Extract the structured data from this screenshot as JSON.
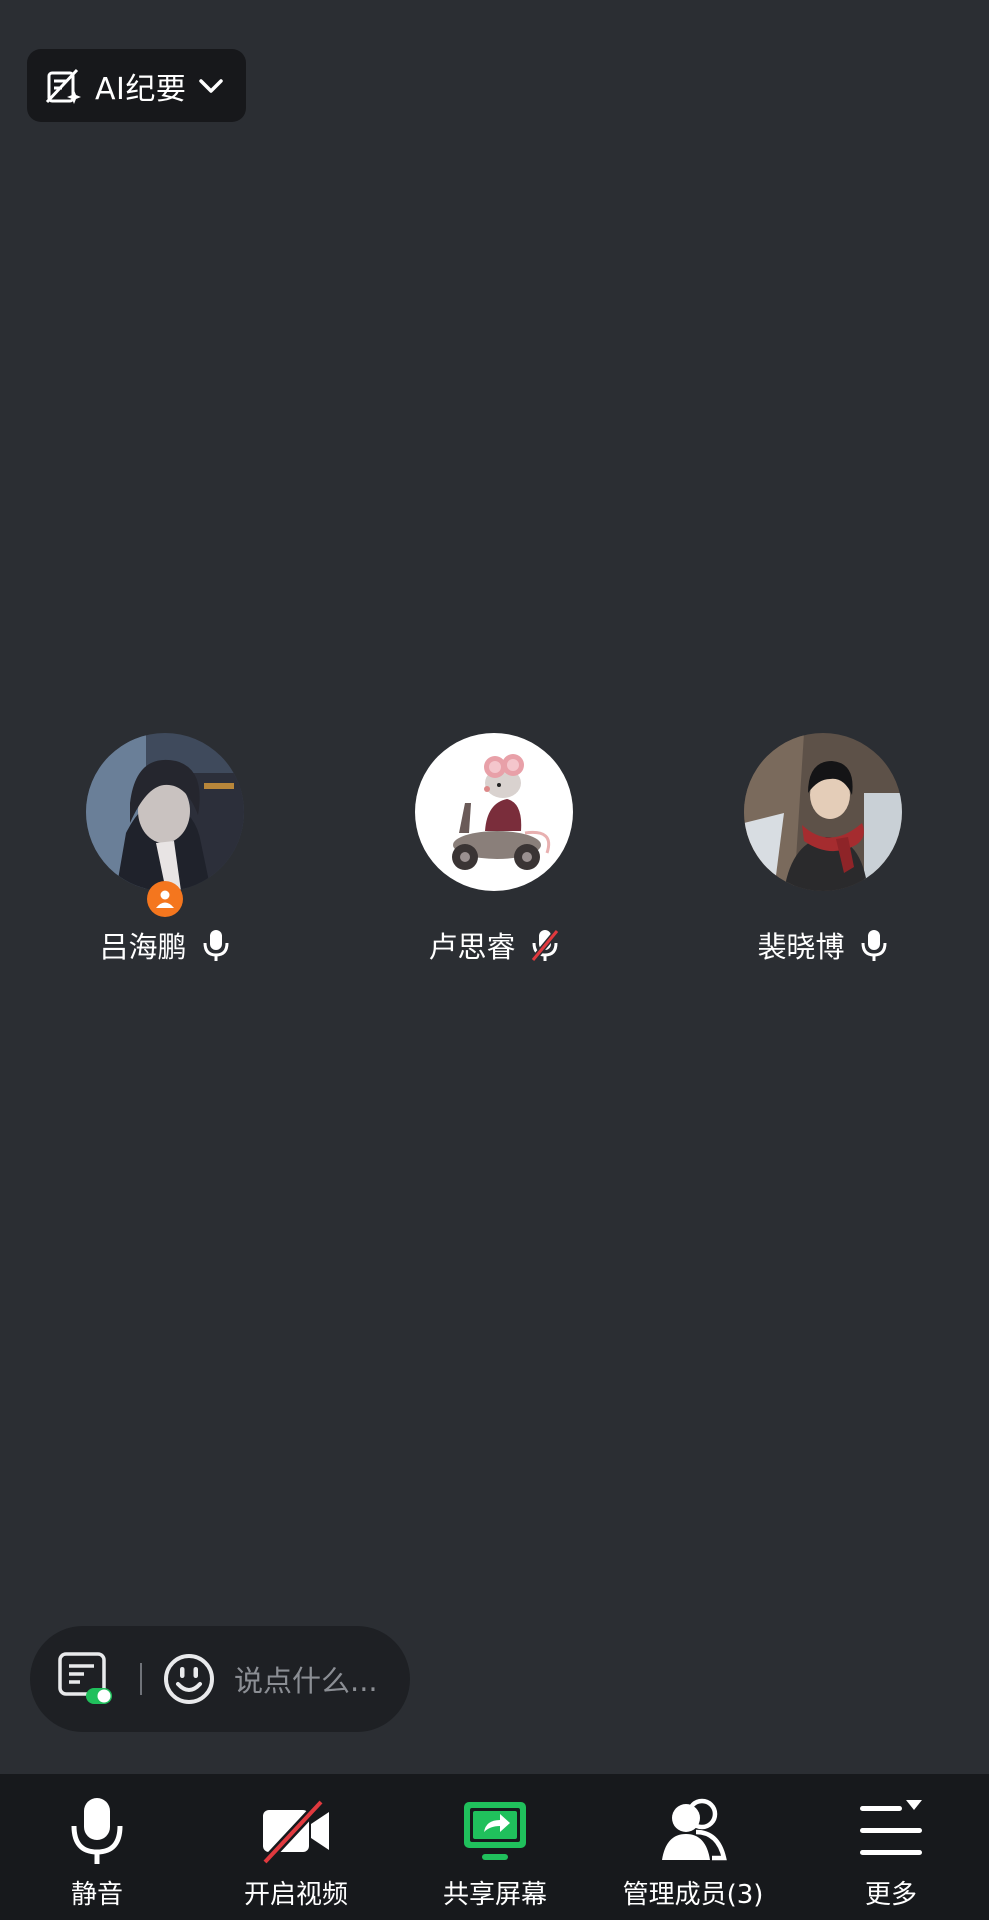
{
  "ai_summary": {
    "label": "AI纪要",
    "icon": "ai-summary-off-icon"
  },
  "participants": [
    {
      "name": "吕海鹏",
      "mic": "on",
      "is_host": true,
      "avatar": "anime-character-avatar"
    },
    {
      "name": "卢思睿",
      "mic": "muted",
      "is_host": false,
      "avatar": "mouse-on-scooter-avatar"
    },
    {
      "name": "裴晓博",
      "mic": "on",
      "is_host": false,
      "avatar": "anime-boy-red-scarf-avatar"
    }
  ],
  "chat": {
    "placeholder": "说点什么..."
  },
  "toolbar": {
    "mute_label": "静音",
    "video_label": "开启视频",
    "share_label": "共享屏幕",
    "members_label": "管理成员(3)",
    "more_label": "更多"
  },
  "colors": {
    "background": "#2b2e33",
    "toolbar_bg": "#17191c",
    "host_badge": "#f4761e",
    "share_green": "#20c05c",
    "muted_red": "#e0393e"
  }
}
